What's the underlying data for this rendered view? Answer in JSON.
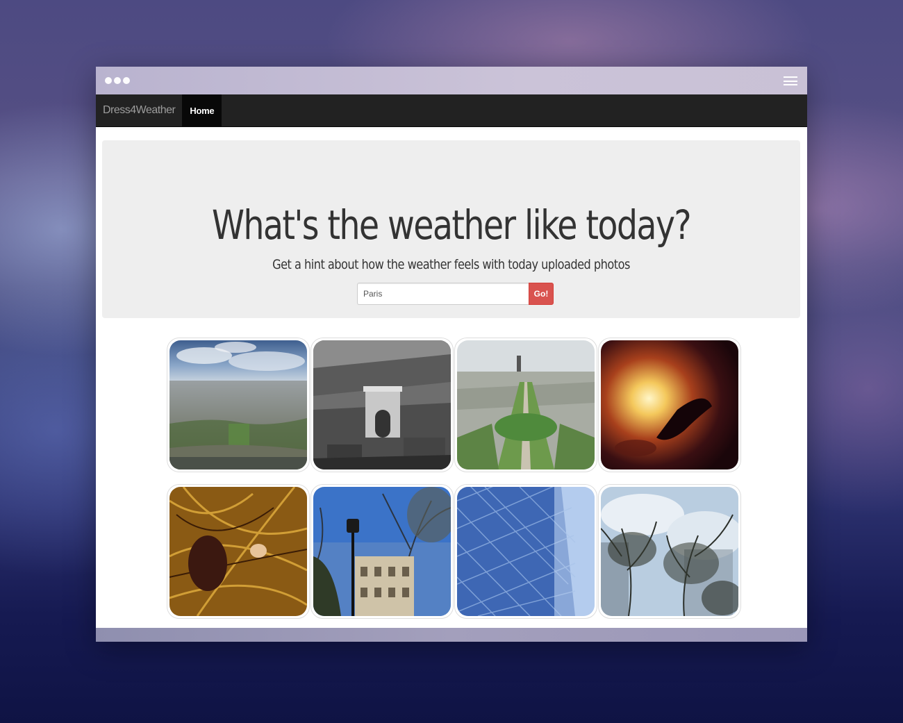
{
  "window": {
    "controls": [
      "dot",
      "dot",
      "dot"
    ],
    "menu_icon": "hamburger-icon"
  },
  "navbar": {
    "brand": "Dress4Weather",
    "home": "Home"
  },
  "hero": {
    "title": "What's the weather like today?",
    "subtitle": "Get a hint about how the weather feels with today uploaded photos",
    "search_value": "Paris",
    "go_label": "Go!"
  },
  "gallery": {
    "photos": [
      "paris-aerial-cityscape-photo",
      "arc-de-triomphe-bw-photo",
      "champ-de-mars-aerial-photo",
      "campfire-photo",
      "autumn-branches-photo",
      "street-lamp-trees-photo",
      "glass-building-photo",
      "trees-against-sky-photo"
    ]
  },
  "colors": {
    "navbar_bg": "#222222",
    "go_button": "#d9534f",
    "jumbotron_bg": "#eeeeee"
  }
}
